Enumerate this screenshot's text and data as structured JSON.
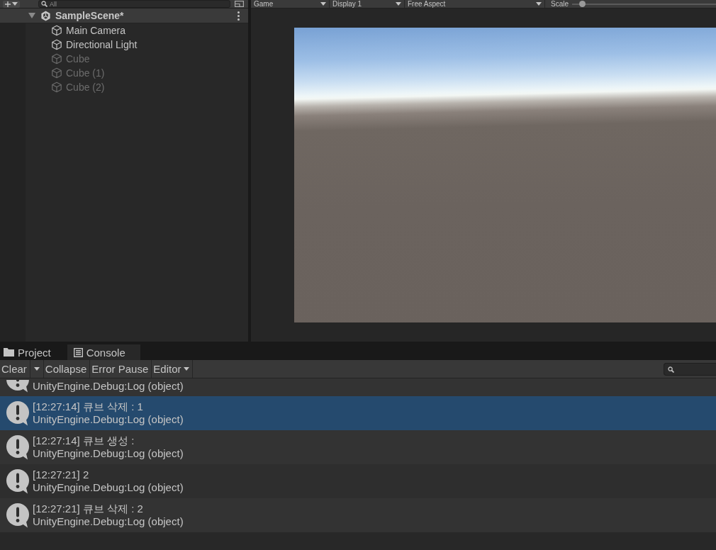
{
  "hierarchy": {
    "toolbar": {
      "search": {
        "placeholder": "All"
      }
    },
    "scene": {
      "name": "SampleScene*",
      "expanded": true,
      "children": [
        {
          "name": "Main Camera",
          "active": true
        },
        {
          "name": "Directional Light",
          "active": true
        },
        {
          "name": "Cube",
          "active": false
        },
        {
          "name": "Cube (1)",
          "active": false
        },
        {
          "name": "Cube (2)",
          "active": false
        }
      ]
    }
  },
  "game": {
    "toolbar": {
      "view": "Game",
      "display": "Display 1",
      "aspect": "Free Aspect",
      "scale_label": "Scale",
      "scale": {
        "level": 0.05
      }
    }
  },
  "console": {
    "tabs": [
      {
        "label": "Project",
        "kind": "project",
        "selected": false
      },
      {
        "label": "Console",
        "kind": "console",
        "selected": true
      }
    ],
    "toolbar": {
      "buttons": [
        {
          "label": "Clear",
          "kind": "split"
        },
        {
          "label": "Collapse",
          "kind": "plain"
        },
        {
          "label": "Error Pause",
          "kind": "plain"
        },
        {
          "label": "Editor",
          "kind": "dropdown"
        }
      ]
    },
    "logs": [
      {
        "trace": "UnityEngine.Debug:Log (object)",
        "selected": false
      },
      {
        "message": "[12:27:14] 큐브 삭제 : 1",
        "trace": "UnityEngine.Debug:Log (object)",
        "selected": true
      },
      {
        "message": "[12:27:14] 큐브 생성 :",
        "trace": "UnityEngine.Debug:Log (object)",
        "selected": false
      },
      {
        "message": "[12:27:21] 2",
        "trace": "UnityEngine.Debug:Log (object)",
        "selected": false
      },
      {
        "message": "[12:27:21] 큐브 삭제 : 2",
        "trace": "UnityEngine.Debug:Log (object)",
        "selected": false
      }
    ]
  }
}
